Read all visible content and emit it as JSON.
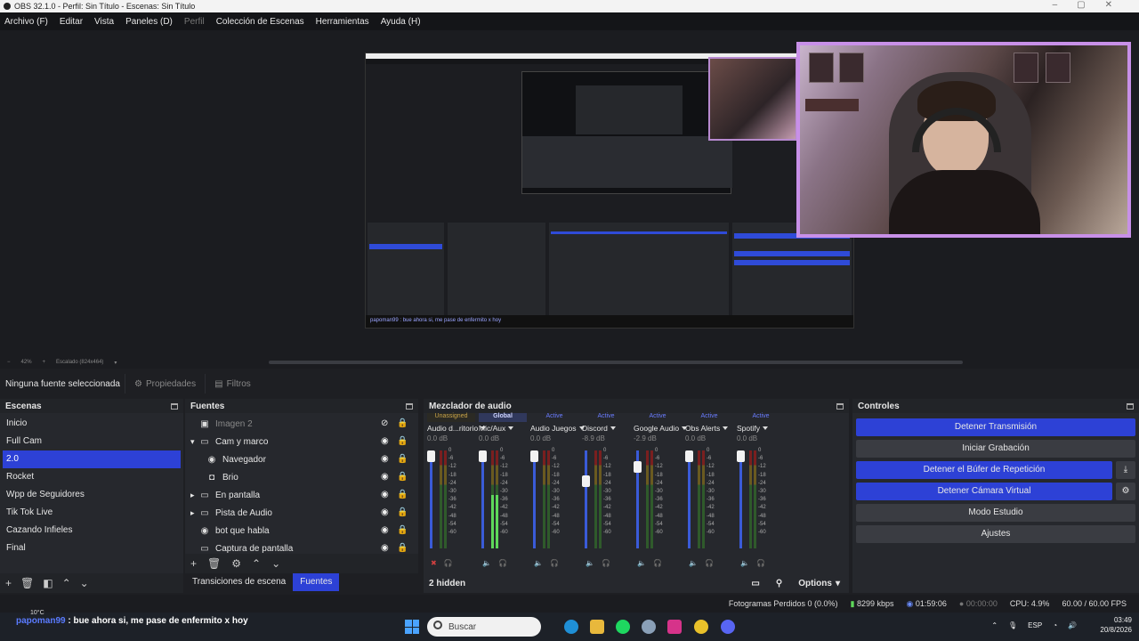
{
  "window": {
    "title": "OBS 32.1.0 - Perfil: Sin Título - Escenas: Sin Título"
  },
  "menu": [
    {
      "label": "Archivo (F)",
      "disabled": false
    },
    {
      "label": "Editar",
      "disabled": false
    },
    {
      "label": "Vista",
      "disabled": false
    },
    {
      "label": "Paneles (D)",
      "disabled": false
    },
    {
      "label": "Perfil",
      "disabled": true
    },
    {
      "label": "Colección de Escenas",
      "disabled": false
    },
    {
      "label": "Herramientas",
      "disabled": false
    },
    {
      "label": "Ayuda (H)",
      "disabled": false
    }
  ],
  "preview": {
    "zoom": "42%",
    "scale_label": "Escalado (824x464)",
    "nested_chat": "papoman99 : bue ahora si, me pase de enfermito x hoy"
  },
  "source_toolbar": {
    "no_source": "Ninguna fuente seleccionada",
    "properties": "Propiedades",
    "filters": "Filtros"
  },
  "scenes": {
    "title": "Escenas",
    "items": [
      "Inicio",
      "Full Cam",
      "2.0",
      "Rocket",
      "Wpp de Seguidores",
      "Tik Tok Live",
      "Cazando Infieles",
      "Final"
    ],
    "selected": "2.0"
  },
  "sources": {
    "title": "Fuentes",
    "items": [
      {
        "label": "Imagen 2",
        "icon": "image-icon",
        "glyph": "▣",
        "indent": 0,
        "expander": "",
        "hidden": true
      },
      {
        "label": "Cam y marco",
        "icon": "folder-icon",
        "glyph": "▭",
        "indent": 0,
        "expander": "▾",
        "hidden": false
      },
      {
        "label": "Navegador",
        "icon": "browser-icon",
        "glyph": "◉",
        "indent": 1,
        "expander": "",
        "hidden": false
      },
      {
        "label": "Brio",
        "icon": "camera-icon",
        "glyph": "◘",
        "indent": 1,
        "expander": "",
        "hidden": false
      },
      {
        "label": "En pantalla",
        "icon": "folder-icon",
        "glyph": "▭",
        "indent": 0,
        "expander": "▸",
        "hidden": false
      },
      {
        "label": "Pista de Audio",
        "icon": "folder-icon",
        "glyph": "▭",
        "indent": 0,
        "expander": "▸",
        "hidden": false
      },
      {
        "label": "bot que habla",
        "icon": "browser-icon",
        "glyph": "◉",
        "indent": 0,
        "expander": "",
        "hidden": false
      },
      {
        "label": "Captura de pantalla",
        "icon": "display-icon",
        "glyph": "▭",
        "indent": 0,
        "expander": "",
        "hidden": false
      }
    ]
  },
  "bottom_tabs": {
    "transitions": "Transiciones de escena",
    "sources": "Fuentes"
  },
  "mixer": {
    "title": "Mezclador de audio",
    "hidden_count": "2 hidden",
    "options": "Options",
    "channels": [
      {
        "status": "Unassigned",
        "name": "Audio d...ritorio",
        "db": "0.0 dB",
        "fader": 1.0,
        "level": 0.0,
        "muted": true
      },
      {
        "status": "Global",
        "name": "Mic/Aux",
        "db": "0.0 dB",
        "fader": 1.0,
        "level": 0.55,
        "muted": false
      },
      {
        "status": "Active",
        "name": "Audio Juegos",
        "db": "0.0 dB",
        "fader": 1.0,
        "level": 0.0,
        "muted": false
      },
      {
        "status": "Active",
        "name": "Discord",
        "db": "-8.9 dB",
        "fader": 0.72,
        "level": 0.0,
        "muted": false
      },
      {
        "status": "Active",
        "name": "Google Audio",
        "db": "-2.9 dB",
        "fader": 0.88,
        "level": 0.0,
        "muted": false
      },
      {
        "status": "Active",
        "name": "Obs Alerts",
        "db": "0.0 dB",
        "fader": 1.0,
        "level": 0.0,
        "muted": false
      },
      {
        "status": "Active",
        "name": "Spotify",
        "db": "0.0 dB",
        "fader": 1.0,
        "level": 0.0,
        "muted": false
      }
    ],
    "scale": [
      "0",
      "-6",
      "-12",
      "-18",
      "-24",
      "-30",
      "-36",
      "-42",
      "-48",
      "-54",
      "-60"
    ]
  },
  "controls": {
    "title": "Controles",
    "buttons": [
      {
        "label": "Detener Transmisión",
        "active": true
      },
      {
        "label": "Iniciar Grabación",
        "active": false
      },
      {
        "label": "Detener el Búfer de Repetición",
        "active": true
      },
      {
        "label": "Detener Cámara Virtual",
        "active": true
      },
      {
        "label": "Modo Estudio",
        "active": false
      },
      {
        "label": "Ajustes",
        "active": false
      }
    ]
  },
  "status": {
    "dropped": "Fotogramas Perdidos 0 (0.0%)",
    "bitrate": "8299 kbps",
    "stream_time": "01:59:06",
    "rec_time": "00:00:00",
    "cpu": "CPU: 4.9%",
    "fps": "60.00 / 60.00 FPS"
  },
  "taskbar": {
    "weather": "10°C",
    "chat_user": "papoman99",
    "chat_text": " : bue ahora si, me pase de enfermito x hoy",
    "search_placeholder": "Buscar",
    "lang": "ESP",
    "time": "03:49",
    "date": "20/8/2026"
  },
  "colors": {
    "accent": "#2d41d6",
    "meter_green": "#5ed85a",
    "cam_border": "#c890e8"
  }
}
